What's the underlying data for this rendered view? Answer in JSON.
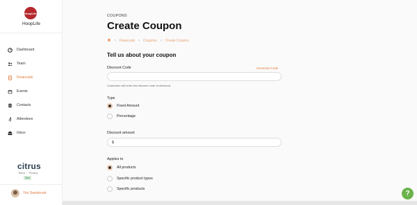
{
  "app": {
    "logo_text": "HoopLife",
    "name": "HoopLife"
  },
  "sidebar": {
    "items": [
      {
        "label": "Dashboard",
        "icon": "dashboard-icon"
      },
      {
        "label": "Team",
        "icon": "team-icon"
      },
      {
        "label": "Financials",
        "icon": "financials-icon"
      },
      {
        "label": "Events",
        "icon": "events-icon"
      },
      {
        "label": "Contacts",
        "icon": "contacts-icon"
      },
      {
        "label": "Attendees",
        "icon": "attendees-icon"
      },
      {
        "label": "Inbox",
        "icon": "inbox-icon"
      }
    ],
    "active_item": "Financials"
  },
  "footer": {
    "brand": "citrus",
    "terms": "Terms",
    "separator": "·",
    "privacy": "Privacy",
    "badge": "Test"
  },
  "user": {
    "name": "Tori Sambrook"
  },
  "header": {
    "eyebrow": "COUPONS",
    "title": "Create Coupon",
    "breadcrumb": [
      "Financials",
      "Coupons",
      "Create Coupon"
    ],
    "breadcrumb_sep": ">"
  },
  "form": {
    "section_title": "Tell us about your coupon",
    "discount_code": {
      "label": "Discount Code",
      "value": "",
      "generate_label": "Generate Code",
      "help": "Customers will enter this discount code at checkout."
    },
    "type": {
      "label": "Type",
      "options": [
        "Fixed Amount",
        "Percentage"
      ],
      "selected": "Fixed Amount"
    },
    "discount_amount": {
      "label": "Discount amount",
      "prefix": "$",
      "value": ""
    },
    "applies_to": {
      "label": "Applies to",
      "options": [
        "All products",
        "Specific product types",
        "Specific products"
      ],
      "selected": "All products"
    }
  },
  "help_button": {
    "label": "?"
  },
  "colors": {
    "accent": "#e07b3f",
    "brand_red": "#b5282d",
    "help_green": "#6bb34a",
    "citrus_navy": "#2d3e50"
  }
}
